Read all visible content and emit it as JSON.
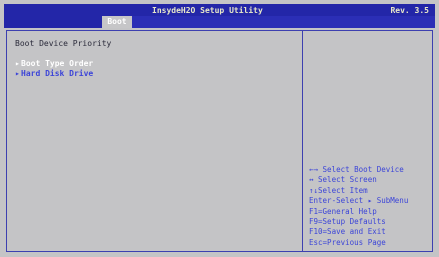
{
  "header": {
    "title": "InsydeH2O Setup Utility",
    "revision": "Rev. 3.5"
  },
  "tabs": [
    {
      "label": "Boot"
    }
  ],
  "page": {
    "title": "Boot Device Priority"
  },
  "menu": {
    "items": [
      {
        "label": "Boot Type Order",
        "arrow": "▸"
      },
      {
        "label": "Hard Disk Drive",
        "arrow": "▸"
      }
    ]
  },
  "help": {
    "lines": [
      "←→  Select Boot Device",
      "↔   Select Screen",
      "↑↓Select Item",
      "Enter-Select ▸ SubMenu",
      "F1=General Help",
      "F9=Setup Defaults",
      "F10=Save and Exit",
      "Esc=Previous Page"
    ]
  },
  "colors": {
    "title_bar": "#2326a8",
    "background": "#c4c4c6",
    "accent_text": "#3c45d8",
    "selected_text": "#ffffff"
  }
}
